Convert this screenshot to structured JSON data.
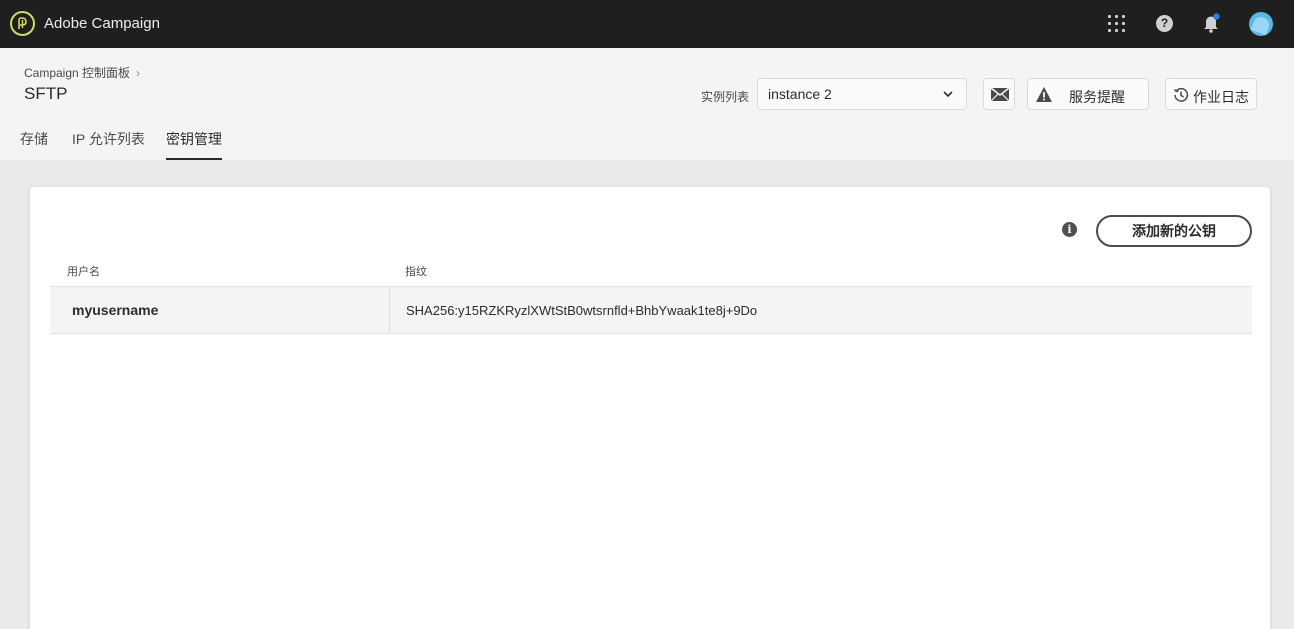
{
  "app": {
    "title": "Adobe Campaign"
  },
  "header": {
    "breadcrumb": "Campaign 控制面板",
    "page_title": "SFTP",
    "instance_label": "实例列表",
    "instance_selected": "instance 2",
    "service_alert_label": "服务提醒",
    "job_log_label": "作业日志"
  },
  "tabs": [
    {
      "label": "存储",
      "active": false
    },
    {
      "label": "IP 允许列表",
      "active": false
    },
    {
      "label": "密钥管理",
      "active": true
    }
  ],
  "content": {
    "add_button_label": "添加新的公钥",
    "columns": [
      "用户名",
      "指纹"
    ],
    "rows": [
      {
        "username": "myusername",
        "fingerprint": "SHA256:y15RZKRyzlXWtStB0wtsrnfld+BhbYwaak1te8j+9Do"
      }
    ]
  },
  "colors": {
    "topbar": "#1f1f1f",
    "logo_ring": "#d2d968",
    "notification_dot": "#2680eb",
    "avatar": "#5ab8e8"
  },
  "icons": {
    "logo": "adobe-campaign-logo",
    "apps": "apps-grid-icon",
    "help": "help-icon",
    "notifications": "bell-icon",
    "caret": "chevron-down-icon",
    "mail": "mail-alert-icon",
    "alert": "warning-icon",
    "log": "history-icon",
    "info": "info-icon"
  }
}
